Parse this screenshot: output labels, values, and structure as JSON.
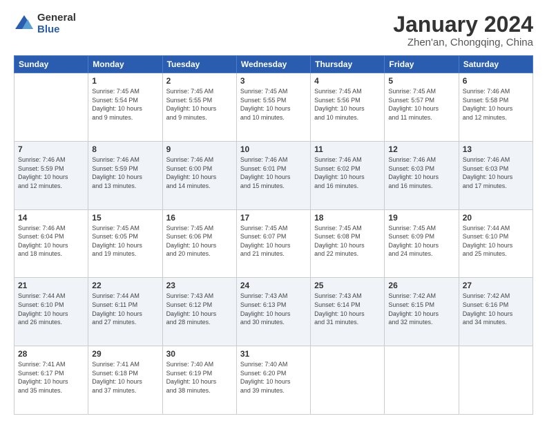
{
  "logo": {
    "general": "General",
    "blue": "Blue"
  },
  "header": {
    "title": "January 2024",
    "subtitle": "Zhen'an, Chongqing, China"
  },
  "weekdays": [
    "Sunday",
    "Monday",
    "Tuesday",
    "Wednesday",
    "Thursday",
    "Friday",
    "Saturday"
  ],
  "weeks": [
    [
      {
        "day": "",
        "info": ""
      },
      {
        "day": "1",
        "info": "Sunrise: 7:45 AM\nSunset: 5:54 PM\nDaylight: 10 hours\nand 9 minutes."
      },
      {
        "day": "2",
        "info": "Sunrise: 7:45 AM\nSunset: 5:55 PM\nDaylight: 10 hours\nand 9 minutes."
      },
      {
        "day": "3",
        "info": "Sunrise: 7:45 AM\nSunset: 5:55 PM\nDaylight: 10 hours\nand 10 minutes."
      },
      {
        "day": "4",
        "info": "Sunrise: 7:45 AM\nSunset: 5:56 PM\nDaylight: 10 hours\nand 10 minutes."
      },
      {
        "day": "5",
        "info": "Sunrise: 7:45 AM\nSunset: 5:57 PM\nDaylight: 10 hours\nand 11 minutes."
      },
      {
        "day": "6",
        "info": "Sunrise: 7:46 AM\nSunset: 5:58 PM\nDaylight: 10 hours\nand 12 minutes."
      }
    ],
    [
      {
        "day": "7",
        "info": "Sunrise: 7:46 AM\nSunset: 5:59 PM\nDaylight: 10 hours\nand 12 minutes."
      },
      {
        "day": "8",
        "info": "Sunrise: 7:46 AM\nSunset: 5:59 PM\nDaylight: 10 hours\nand 13 minutes."
      },
      {
        "day": "9",
        "info": "Sunrise: 7:46 AM\nSunset: 6:00 PM\nDaylight: 10 hours\nand 14 minutes."
      },
      {
        "day": "10",
        "info": "Sunrise: 7:46 AM\nSunset: 6:01 PM\nDaylight: 10 hours\nand 15 minutes."
      },
      {
        "day": "11",
        "info": "Sunrise: 7:46 AM\nSunset: 6:02 PM\nDaylight: 10 hours\nand 16 minutes."
      },
      {
        "day": "12",
        "info": "Sunrise: 7:46 AM\nSunset: 6:03 PM\nDaylight: 10 hours\nand 16 minutes."
      },
      {
        "day": "13",
        "info": "Sunrise: 7:46 AM\nSunset: 6:03 PM\nDaylight: 10 hours\nand 17 minutes."
      }
    ],
    [
      {
        "day": "14",
        "info": "Sunrise: 7:46 AM\nSunset: 6:04 PM\nDaylight: 10 hours\nand 18 minutes."
      },
      {
        "day": "15",
        "info": "Sunrise: 7:45 AM\nSunset: 6:05 PM\nDaylight: 10 hours\nand 19 minutes."
      },
      {
        "day": "16",
        "info": "Sunrise: 7:45 AM\nSunset: 6:06 PM\nDaylight: 10 hours\nand 20 minutes."
      },
      {
        "day": "17",
        "info": "Sunrise: 7:45 AM\nSunset: 6:07 PM\nDaylight: 10 hours\nand 21 minutes."
      },
      {
        "day": "18",
        "info": "Sunrise: 7:45 AM\nSunset: 6:08 PM\nDaylight: 10 hours\nand 22 minutes."
      },
      {
        "day": "19",
        "info": "Sunrise: 7:45 AM\nSunset: 6:09 PM\nDaylight: 10 hours\nand 24 minutes."
      },
      {
        "day": "20",
        "info": "Sunrise: 7:44 AM\nSunset: 6:10 PM\nDaylight: 10 hours\nand 25 minutes."
      }
    ],
    [
      {
        "day": "21",
        "info": "Sunrise: 7:44 AM\nSunset: 6:10 PM\nDaylight: 10 hours\nand 26 minutes."
      },
      {
        "day": "22",
        "info": "Sunrise: 7:44 AM\nSunset: 6:11 PM\nDaylight: 10 hours\nand 27 minutes."
      },
      {
        "day": "23",
        "info": "Sunrise: 7:43 AM\nSunset: 6:12 PM\nDaylight: 10 hours\nand 28 minutes."
      },
      {
        "day": "24",
        "info": "Sunrise: 7:43 AM\nSunset: 6:13 PM\nDaylight: 10 hours\nand 30 minutes."
      },
      {
        "day": "25",
        "info": "Sunrise: 7:43 AM\nSunset: 6:14 PM\nDaylight: 10 hours\nand 31 minutes."
      },
      {
        "day": "26",
        "info": "Sunrise: 7:42 AM\nSunset: 6:15 PM\nDaylight: 10 hours\nand 32 minutes."
      },
      {
        "day": "27",
        "info": "Sunrise: 7:42 AM\nSunset: 6:16 PM\nDaylight: 10 hours\nand 34 minutes."
      }
    ],
    [
      {
        "day": "28",
        "info": "Sunrise: 7:41 AM\nSunset: 6:17 PM\nDaylight: 10 hours\nand 35 minutes."
      },
      {
        "day": "29",
        "info": "Sunrise: 7:41 AM\nSunset: 6:18 PM\nDaylight: 10 hours\nand 37 minutes."
      },
      {
        "day": "30",
        "info": "Sunrise: 7:40 AM\nSunset: 6:19 PM\nDaylight: 10 hours\nand 38 minutes."
      },
      {
        "day": "31",
        "info": "Sunrise: 7:40 AM\nSunset: 6:20 PM\nDaylight: 10 hours\nand 39 minutes."
      },
      {
        "day": "",
        "info": ""
      },
      {
        "day": "",
        "info": ""
      },
      {
        "day": "",
        "info": ""
      }
    ]
  ]
}
